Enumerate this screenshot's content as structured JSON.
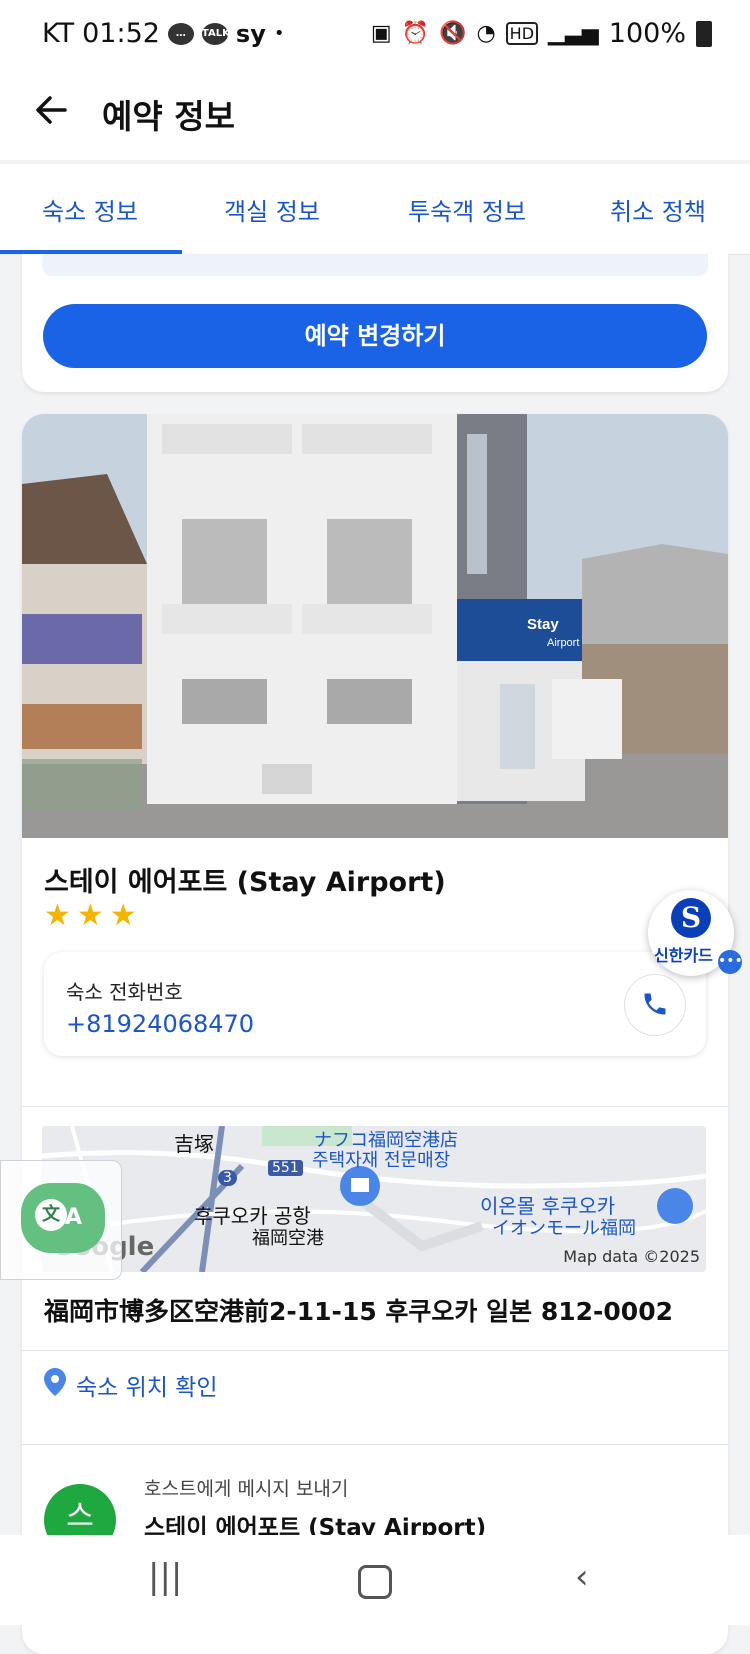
{
  "status_bar": {
    "carrier": "KT",
    "time": "01:52",
    "talk_badge": "TALK",
    "sy_badge": "sy",
    "dot": "•",
    "battery": "100%"
  },
  "header": {
    "title": "예약 정보"
  },
  "tabs": [
    {
      "label": "숙소 정보",
      "active": true
    },
    {
      "label": "객실 정보",
      "active": false
    },
    {
      "label": "투숙객 정보",
      "active": false
    },
    {
      "label": "취소 정책",
      "active": false
    }
  ],
  "booking": {
    "change_button": "예약 변경하기"
  },
  "property": {
    "name": "스테이 에어포트 (Stay Airport)",
    "stars": "★★★",
    "photo_sign": [
      "Stay",
      "Airport"
    ],
    "phone_label": "숙소 전화번호",
    "phone_number": "+81924068470",
    "address": "福岡市博多区空港前2-11-15 후쿠오카 일본 812-0002",
    "location_link": "숙소 위치 확인",
    "host_label": "호스트에게 메시지 보내기",
    "host_name": "스테이 에어포트 (Stay Airport)",
    "host_avatar": "스"
  },
  "map": {
    "labels": [
      "吉塚",
      "ナフコ福岡空港店",
      "주택자재 전문매장",
      "551",
      "3",
      "후쿠오카 공항",
      "福岡空港",
      "이온몰 후쿠오카",
      "イオンモール福岡"
    ],
    "google": "Google",
    "credit": "Map data ©2025"
  },
  "floating": {
    "shinhan_logo": "S",
    "shinhan_label": "신한카드"
  },
  "translate": {
    "glyph1": "文",
    "glyph2": "A"
  }
}
